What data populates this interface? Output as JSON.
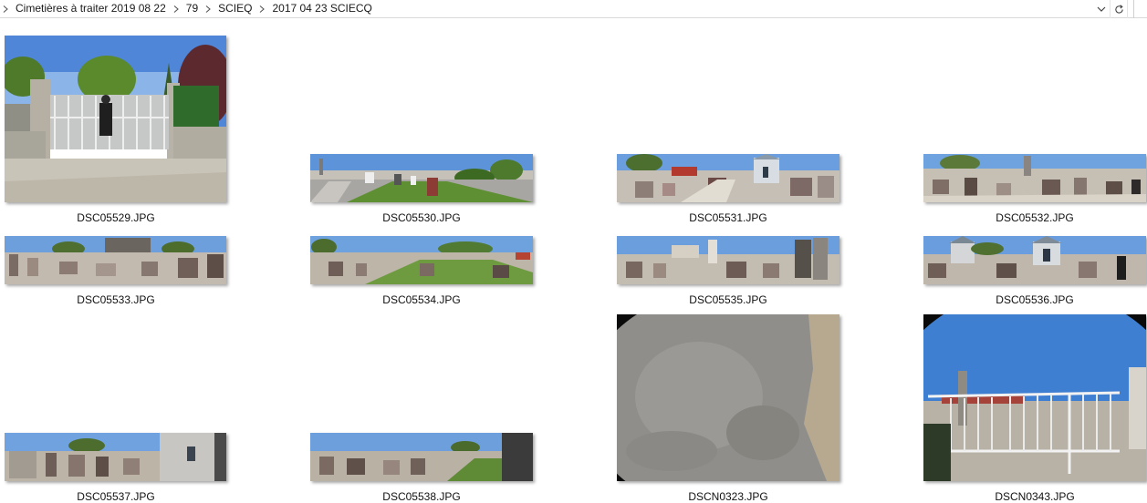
{
  "address_bar": {
    "breadcrumbs": [
      {
        "label": "Cimetières à traiter 2019 08 22"
      },
      {
        "label": "79"
      },
      {
        "label": "SCIEQ"
      },
      {
        "label": "2017 04 23 SCIECQ"
      }
    ]
  },
  "files": [
    {
      "name": "DSC05529.JPG"
    },
    {
      "name": "DSC05530.JPG"
    },
    {
      "name": "DSC05531.JPG"
    },
    {
      "name": "DSC05532.JPG"
    },
    {
      "name": "DSC05533.JPG"
    },
    {
      "name": "DSC05534.JPG"
    },
    {
      "name": "DSC05535.JPG"
    },
    {
      "name": "DSC05536.JPG"
    },
    {
      "name": "DSC05537.JPG"
    },
    {
      "name": "DSC05538.JPG"
    },
    {
      "name": "DSCN0323.JPG"
    },
    {
      "name": "DSCN0343.JPG"
    }
  ]
}
